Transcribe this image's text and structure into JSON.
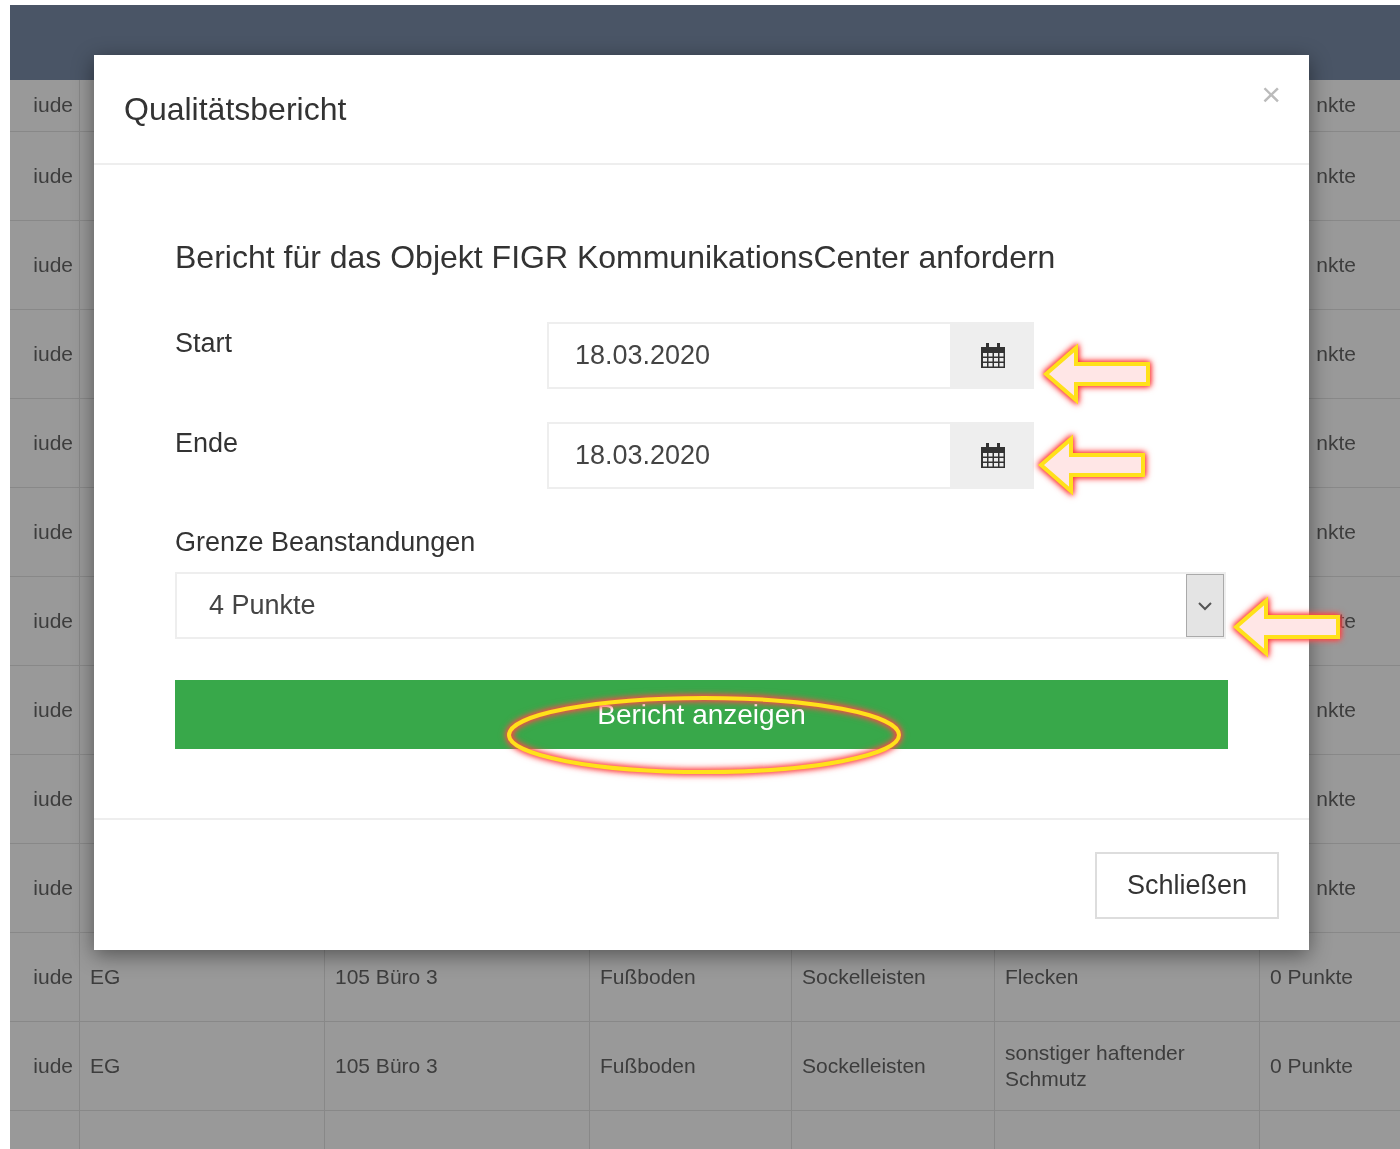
{
  "table": {
    "rows": [
      {
        "column_1": "iude",
        "column_7": "nkte"
      },
      {
        "column_1": "iude",
        "column_7": "nkte"
      },
      {
        "column_1": "iude",
        "column_7": "nkte"
      },
      {
        "column_1": "iude",
        "column_7": "nkte"
      },
      {
        "column_1": "iude",
        "column_7": "nkte"
      },
      {
        "column_1": "iude",
        "column_7": "nkte"
      },
      {
        "column_1": "iude",
        "column_7": "te"
      },
      {
        "column_1": "iude",
        "column_7": "nkte"
      },
      {
        "column_1": "iude",
        "column_7": "nkte"
      },
      {
        "column_1": "iude",
        "column_7": "nkte"
      },
      {
        "column_1": "iude",
        "column_2": "EG",
        "column_3": "105 Büro 3",
        "column_4": "Fußboden",
        "column_5": "Sockelleisten",
        "column_6": "Flecken",
        "column_7": "0 Punkte"
      },
      {
        "column_1": "iude",
        "column_2": "EG",
        "column_3": "105 Büro 3",
        "column_4": "Fußboden",
        "column_5": "Sockelleisten",
        "column_6": "sonstiger haftender Schmutz",
        "column_7": "0 Punkte"
      }
    ]
  },
  "dialog": {
    "title": "Qualitätsbericht",
    "close_icon": "×",
    "heading": "Bericht für das Objekt FIGR KommunikationsCenter anfordern",
    "date_fields": [
      {
        "label": "Start",
        "value": "18.03.2020"
      },
      {
        "label": "Ende",
        "value": "18.03.2020"
      }
    ],
    "limit": {
      "label": "Grenze Beanstandungen",
      "value": "4 Punkte"
    },
    "submit_button": "Bericht anzeigen",
    "close_button": "Schließen"
  }
}
